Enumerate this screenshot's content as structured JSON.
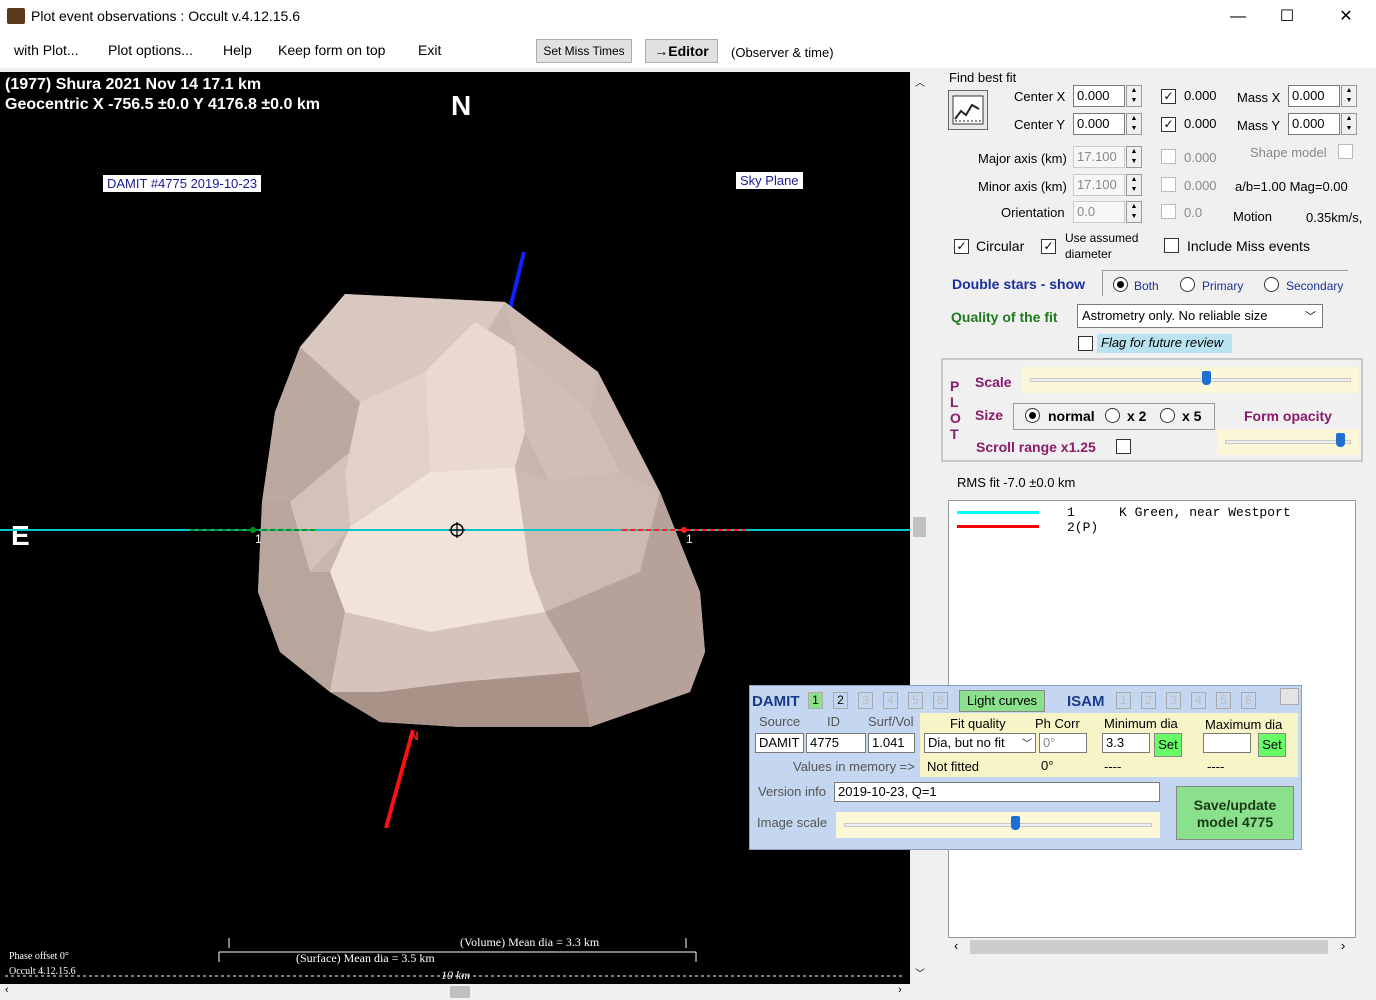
{
  "window": {
    "title": "Plot event observations : Occult v.4.12.15.6",
    "minimize": "—",
    "maximize": "☐",
    "close": "✕"
  },
  "menu": {
    "items": [
      "with Plot...",
      "Plot options...",
      "Help",
      "Keep form on top",
      "Exit"
    ],
    "set_miss_times": "Set Miss Times",
    "editor": "→Editor",
    "observer_time": "(Observer & time)"
  },
  "plot": {
    "line1": "(1977) Shura  2021 Nov 14   17.1 km",
    "line2": "Geocentric  X  -756.5 ±0.0  Y 4176.8 ±0.0 km",
    "north": "N",
    "east": "E",
    "damit_label": "DAMIT #4775 2019-10-23",
    "sky_plane": "Sky Plane",
    "pole_label": "N",
    "chord_label_left": "1",
    "chord_label_right": "1",
    "volume_dia": "(Volume) Mean dia = 3.3 km",
    "surface_dia": "(Surface) Mean dia = 3.5 km",
    "scale_bar": "10 km",
    "phase_offset": "Phase offset 0°",
    "version": "Occult 4.12.15.6"
  },
  "fit": {
    "find_best_fit": "Find best fit",
    "center_x_label": "Center X",
    "center_x": "0.000",
    "center_y_label": "Center Y",
    "center_y": "0.000",
    "cx_check": "0.000",
    "cy_check": "0.000",
    "mass_x_label": "Mass X",
    "mass_x": "0.000",
    "mass_y_label": "Mass Y",
    "mass_y": "0.000",
    "major_label": "Major axis (km)",
    "major": "17.100",
    "major_check": "0.000",
    "minor_label": "Minor axis (km)",
    "minor": "17.100",
    "minor_check": "0.000",
    "orient_label": "Orientation",
    "orient": "0.0",
    "orient_check": "0.0",
    "shape_model": "Shape model",
    "ab_mag": "a/b=1.00 Mag=0.00",
    "motion_label": "Motion",
    "motion": "0.35km/s,",
    "circular": "Circular",
    "use_assumed": "Use assumed",
    "diameter": "diameter",
    "include_miss": "Include Miss events",
    "double_stars": "Double stars - show",
    "both": "Both",
    "primary": "Primary",
    "secondary": "Secondary",
    "quality_label": "Quality of the fit",
    "quality_value": "Astrometry only. No reliable size",
    "flag_review": "Flag for future review"
  },
  "plotctl": {
    "plot_vertical": [
      "P",
      "L",
      "O",
      "T"
    ],
    "scale": "Scale",
    "size": "Size",
    "normal": "normal",
    "x2": "x 2",
    "x5": "x 5",
    "form_opacity": "Form opacity",
    "scroll_range": "Scroll range x1.25",
    "scale_level": 0.55,
    "opacity_level": 0.95
  },
  "rms": "RMS fit -7.0 ±0.0 km",
  "observers": [
    {
      "num": "1",
      "name": "K Green, near Westport",
      "color": "#00ffff"
    },
    {
      "num": "2(P)",
      "name": "",
      "color": "#ff0000"
    }
  ],
  "damit": {
    "title": "DAMIT",
    "tabs": [
      "1",
      "2",
      "3",
      "4",
      "5",
      "6"
    ],
    "light_curves": "Light curves",
    "isam": "ISAM",
    "isam_tabs": [
      "1",
      "2",
      "3",
      "4",
      "5",
      "6"
    ],
    "source_h": "Source",
    "id_h": "ID",
    "surfvol_h": "Surf/Vol",
    "fitq_h": "Fit quality",
    "phcorr_h": "Ph Corr",
    "mindia_h": "Minimum dia",
    "maxdia_h": "Maximum dia",
    "source": "DAMIT",
    "id": "4775",
    "surfvol": "1.041",
    "fitq": "Dia, but no fit",
    "phcorr": "0°",
    "mindia": "3.3",
    "maxdia": "",
    "set": "Set",
    "values_in_memory": "Values in memory =>",
    "mem_fit": "Not fitted",
    "mem_ph": "0°",
    "mem_min": "----",
    "mem_max": "----",
    "version_label": "Version info",
    "version": "2019-10-23, Q=1",
    "image_scale": "Image scale",
    "image_scale_level": 0.56,
    "save_update": "Save/update",
    "model": "model 4775"
  }
}
